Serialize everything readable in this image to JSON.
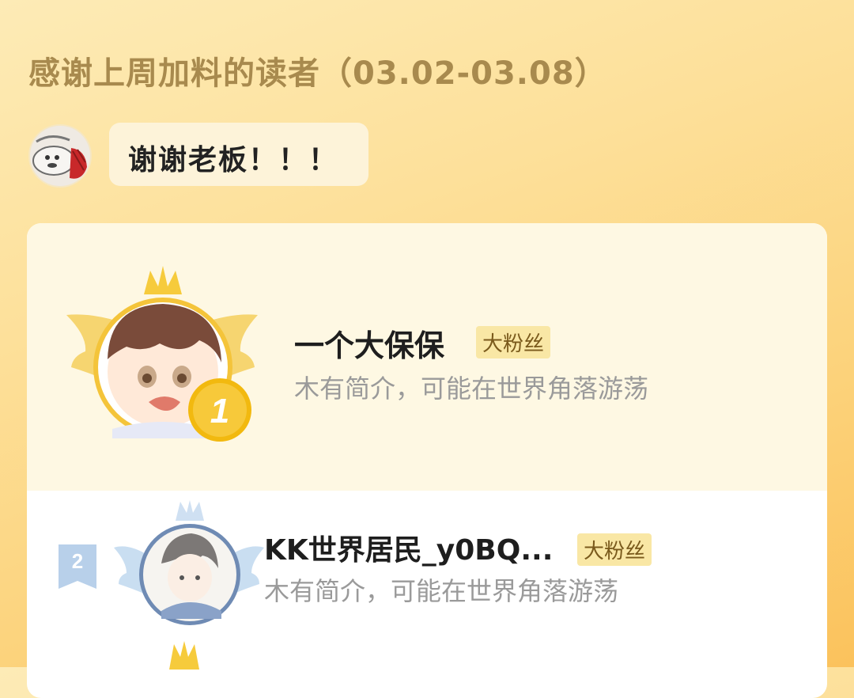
{
  "header": {
    "title": "感谢上周加料的读者（03.02-03.08）"
  },
  "thanks": {
    "message": "谢谢老板！！！"
  },
  "ranking": [
    {
      "rank": "1",
      "name": "一个大保保",
      "badge": "大粉丝",
      "bio": "木有简介，可能在世界角落游荡"
    },
    {
      "rank": "2",
      "name": "KK世界居民_y0BQ...",
      "badge": "大粉丝",
      "bio": "木有简介，可能在世界角落游荡"
    }
  ],
  "colors": {
    "gold": "#f2b90f",
    "silver_blue": "#9fc3e3",
    "badge_bg": "#f9e7a5",
    "title": "#a88a4e"
  }
}
